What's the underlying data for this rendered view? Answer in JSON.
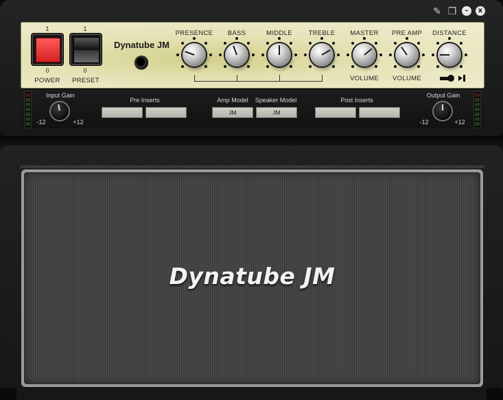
{
  "titlebar": {
    "icons": [
      "pin-icon",
      "copy-icon",
      "minimize-icon",
      "close-icon"
    ],
    "minimize_glyph": "–",
    "close_glyph": "x"
  },
  "amp": {
    "brand": "Dynatube JM",
    "power": {
      "label": "POWER",
      "on": "1",
      "off": "0"
    },
    "preset": {
      "label": "PRESET",
      "on": "1",
      "off": "0"
    },
    "knobs": [
      {
        "label": "PRESENCE",
        "sub": ""
      },
      {
        "label": "BASS",
        "sub": ""
      },
      {
        "label": "MIDDLE",
        "sub": ""
      },
      {
        "label": "TREBLE",
        "sub": ""
      },
      {
        "label": "MASTER",
        "sub": "VOLUME"
      },
      {
        "label": "PRE AMP",
        "sub": "VOLUME"
      },
      {
        "label": "DISTANCE",
        "sub": ""
      }
    ]
  },
  "strip": {
    "input_gain": {
      "label": "Input Gain",
      "min": "-12",
      "max": "+12"
    },
    "pre_inserts": {
      "label": "Pre Inserts"
    },
    "amp_model": {
      "label": "Amp Model",
      "value": "JM"
    },
    "speaker_model": {
      "label": "Speaker Model",
      "value": "JM"
    },
    "post_inserts": {
      "label": "Post Inserts"
    },
    "output_gain": {
      "label": "Output Gain",
      "min": "-12",
      "max": "+12"
    }
  },
  "cabinet": {
    "logo": "Dynatube JM"
  },
  "colors": {
    "panel": "#e6e3b8",
    "power_on": "#e42a2a",
    "body": "#1a1a1a",
    "grille": "#404040"
  }
}
